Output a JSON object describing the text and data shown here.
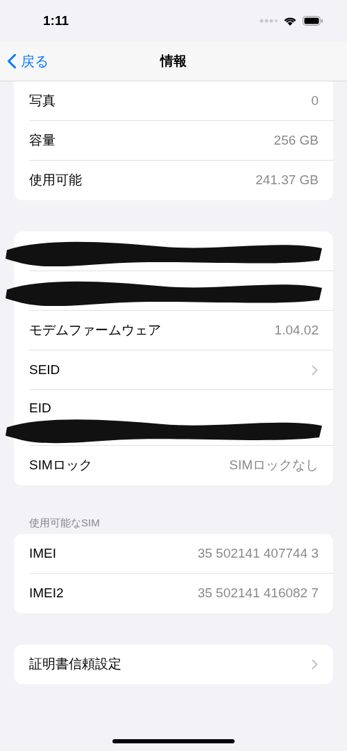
{
  "status_bar": {
    "time": "1:11"
  },
  "nav": {
    "back": "戻る",
    "title": "情報"
  },
  "sections": [
    {
      "rows": [
        {
          "kind": "value",
          "label": "写真",
          "value": "0"
        },
        {
          "kind": "value",
          "label": "容量",
          "value": "256 GB"
        },
        {
          "kind": "value",
          "label": "使用可能",
          "value": "241.37 GB"
        }
      ],
      "top_cut": true
    },
    {
      "rows": [
        {
          "kind": "redacted"
        },
        {
          "kind": "redacted"
        },
        {
          "kind": "value",
          "label": "モデムファームウェア",
          "value": "1.04.02"
        },
        {
          "kind": "link",
          "label": "SEID"
        },
        {
          "kind": "redacted_value",
          "label": "EID"
        },
        {
          "kind": "value",
          "label": "SIMロック",
          "value": "SIMロックなし"
        }
      ]
    },
    {
      "header": "使用可能なSIM",
      "rows": [
        {
          "kind": "value",
          "label": "IMEI",
          "value": "35 502141 407744 3"
        },
        {
          "kind": "value",
          "label": "IMEI2",
          "value": "35 502141 416082 7"
        }
      ]
    },
    {
      "rows": [
        {
          "kind": "link",
          "label": "証明書信頼設定"
        }
      ]
    }
  ]
}
